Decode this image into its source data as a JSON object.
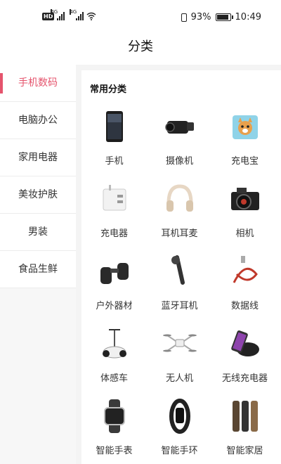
{
  "status": {
    "network_badge": "HD",
    "sig1_tag": "4G",
    "sig2_tag": "4G",
    "battery_percent": "93%",
    "battery_level": 0.93,
    "time": "10:49"
  },
  "header": {
    "title": "分类"
  },
  "sidebar": {
    "items": [
      {
        "label": "手机数码",
        "active": true
      },
      {
        "label": "电脑办公"
      },
      {
        "label": "家用电器"
      },
      {
        "label": "美妆护肤"
      },
      {
        "label": "男装"
      },
      {
        "label": "食品生鲜"
      }
    ]
  },
  "content": {
    "section_title": "常用分类",
    "items": [
      {
        "label": "手机",
        "icon": "phone-icon"
      },
      {
        "label": "摄像机",
        "icon": "camcorder-icon"
      },
      {
        "label": "充电宝",
        "icon": "power-bank-icon"
      },
      {
        "label": "充电器",
        "icon": "charger-icon"
      },
      {
        "label": "耳机耳麦",
        "icon": "headphones-icon"
      },
      {
        "label": "相机",
        "icon": "camera-icon"
      },
      {
        "label": "户外器材",
        "icon": "binoculars-icon"
      },
      {
        "label": "蓝牙耳机",
        "icon": "bluetooth-earpiece-icon"
      },
      {
        "label": "数据线",
        "icon": "data-cable-icon"
      },
      {
        "label": "体感车",
        "icon": "balance-scooter-icon"
      },
      {
        "label": "无人机",
        "icon": "drone-icon"
      },
      {
        "label": "无线充电器",
        "icon": "wireless-charger-icon"
      },
      {
        "label": "智能手表",
        "icon": "smartwatch-icon"
      },
      {
        "label": "智能手环",
        "icon": "fitness-band-icon"
      },
      {
        "label": "智能家居",
        "icon": "smart-lock-icon"
      }
    ]
  },
  "colors": {
    "accent": "#e5546d"
  }
}
